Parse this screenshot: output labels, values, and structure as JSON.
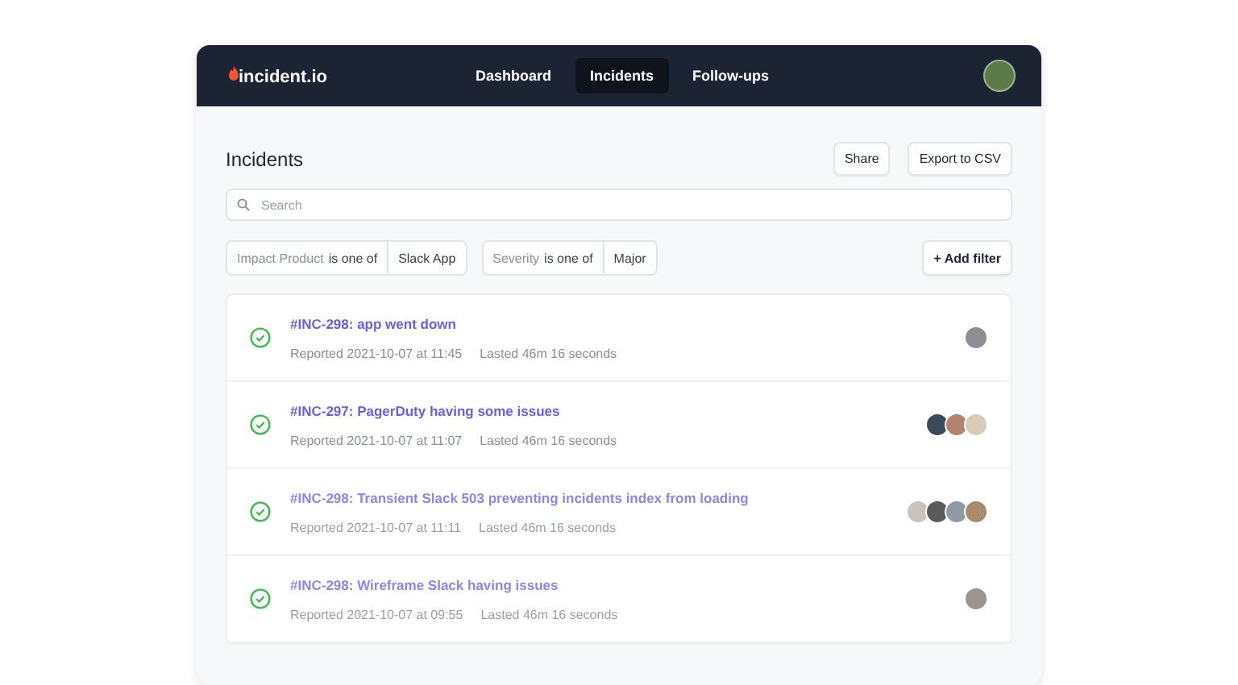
{
  "navbar": {
    "logo": "incident.io",
    "tabs": [
      {
        "label": "Dashboard",
        "selected": false
      },
      {
        "label": "Incidents",
        "selected": true
      },
      {
        "label": "Follow-ups",
        "selected": false
      }
    ]
  },
  "page": {
    "title": "Incidents",
    "buttons": [
      "Share",
      "Export to CSV"
    ]
  },
  "search": {
    "placeholder": "Search"
  },
  "filters": [
    {
      "field": "Impact Product",
      "operator": "is one of",
      "value": "Slack App"
    },
    {
      "field": "Severity",
      "operator": "is one of",
      "value": "Major"
    }
  ],
  "add_filter": "+ Add filter",
  "incidents": [
    {
      "kind": "resolved",
      "dimmed": false,
      "title": "#INC-298: app went down",
      "reported": "Reported 2021-10-07 at 11:45",
      "lasted": "Lasted 46m 16 seconds",
      "avatars": [
        {
          "color": "#8d8f94"
        }
      ]
    },
    {
      "kind": "resolved",
      "dimmed": false,
      "title": "#INC-297: PagerDuty having some issues",
      "reported": "Reported 2021-10-07 at 11:07",
      "lasted": "Lasted 46m 16 seconds",
      "avatars": [
        {
          "color": "#3b4a5a"
        },
        {
          "color": "#b08470"
        },
        {
          "color": "#d8cbb8"
        }
      ]
    },
    {
      "kind": "resolved",
      "dimmed": true,
      "title": "#INC-298: Transient Slack 503 preventing incidents index from loading",
      "reported": "Reported 2021-10-07 at 11:11",
      "lasted": "Lasted 46m 16 seconds",
      "avatars": [
        {
          "color": "#c9c3bb"
        },
        {
          "color": "#5a5a5a"
        },
        {
          "color": "#8e9aa6"
        },
        {
          "color": "#a88a6c"
        }
      ]
    },
    {
      "kind": "resolved",
      "dimmed": true,
      "title": "#INC-298: Wireframe Slack having issues",
      "reported": "Reported 2021-10-07 at 09:55",
      "lasted": "Lasted 46m 16 seconds",
      "avatars": [
        {
          "color": "#9a9590"
        }
      ]
    }
  ]
}
